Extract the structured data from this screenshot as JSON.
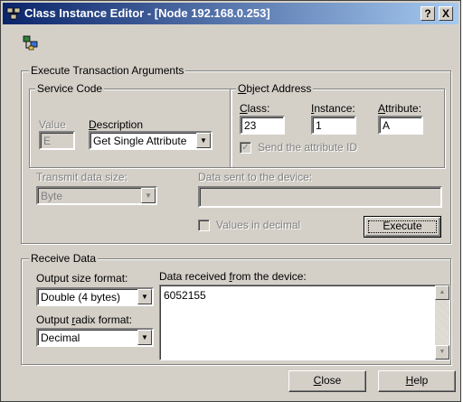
{
  "window": {
    "title": "Class Instance Editor - [Node 192.168.0.253]",
    "help_button": "?",
    "close_button": "X"
  },
  "execute_group": {
    "legend": "Execute Transaction Arguments",
    "service_code": {
      "legend": "Service Code",
      "value_label": "Value",
      "value": "E",
      "description_label": "Description",
      "description_value": "Get Single Attribute"
    },
    "object_address": {
      "legend": "Object Address",
      "class_label": "Class:",
      "class_value": "23",
      "instance_label": "Instance:",
      "instance_value": "1",
      "attribute_label": "Attribute:",
      "attribute_value": "A",
      "send_attr_label": "Send the attribute ID",
      "send_attr_checked": true
    },
    "transmit_label": "Transmit data size:",
    "transmit_value": "Byte",
    "data_sent_label": "Data sent to the device:",
    "data_sent_value": "",
    "values_decimal_label": "Values in decimal",
    "values_decimal_checked": false,
    "execute_button": "Execute"
  },
  "receive_group": {
    "legend": "Receive Data",
    "output_size_label": "Output size format:",
    "output_size_value": "Double (4 bytes)",
    "output_radix_label": "Output radix format:",
    "output_radix_value": "Decimal",
    "data_received_label": "Data received from the device:",
    "data_received_value": "6052155"
  },
  "footer": {
    "close_button": "Close",
    "help_button": "Help"
  },
  "icons": {
    "app": "class-editor-icon",
    "toolbar": "node-tree-icon"
  }
}
